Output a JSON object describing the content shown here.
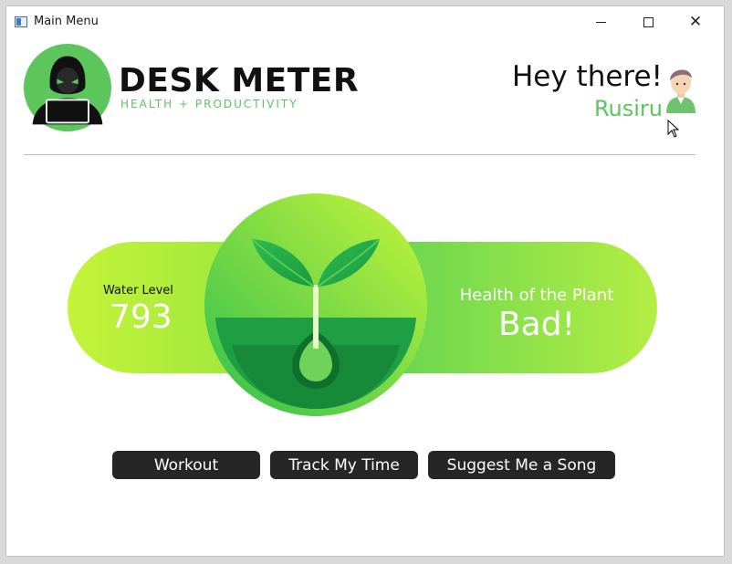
{
  "window": {
    "title": "Main Menu"
  },
  "brand": {
    "name": "DESK METER",
    "tagline": "HEALTH + PRODUCTIVITY"
  },
  "user": {
    "greeting": "Hey there!",
    "name": "Rusiru"
  },
  "stats": {
    "water_label": "Water Level",
    "water_value": "793",
    "health_label": "Health of the Plant",
    "health_value": "Bad!"
  },
  "buttons": {
    "workout": "Workout",
    "track_time": "Track My Time",
    "suggest_song": "Suggest Me a Song"
  },
  "colors": {
    "accent_green": "#5cc55c",
    "button_dark": "#262626"
  },
  "icons": [
    "app-window-icon",
    "minimize-icon",
    "maximize-icon",
    "close-icon",
    "hacker-logo-icon",
    "user-avatar-icon",
    "plant-sprout-icon",
    "mouse-cursor-icon"
  ]
}
